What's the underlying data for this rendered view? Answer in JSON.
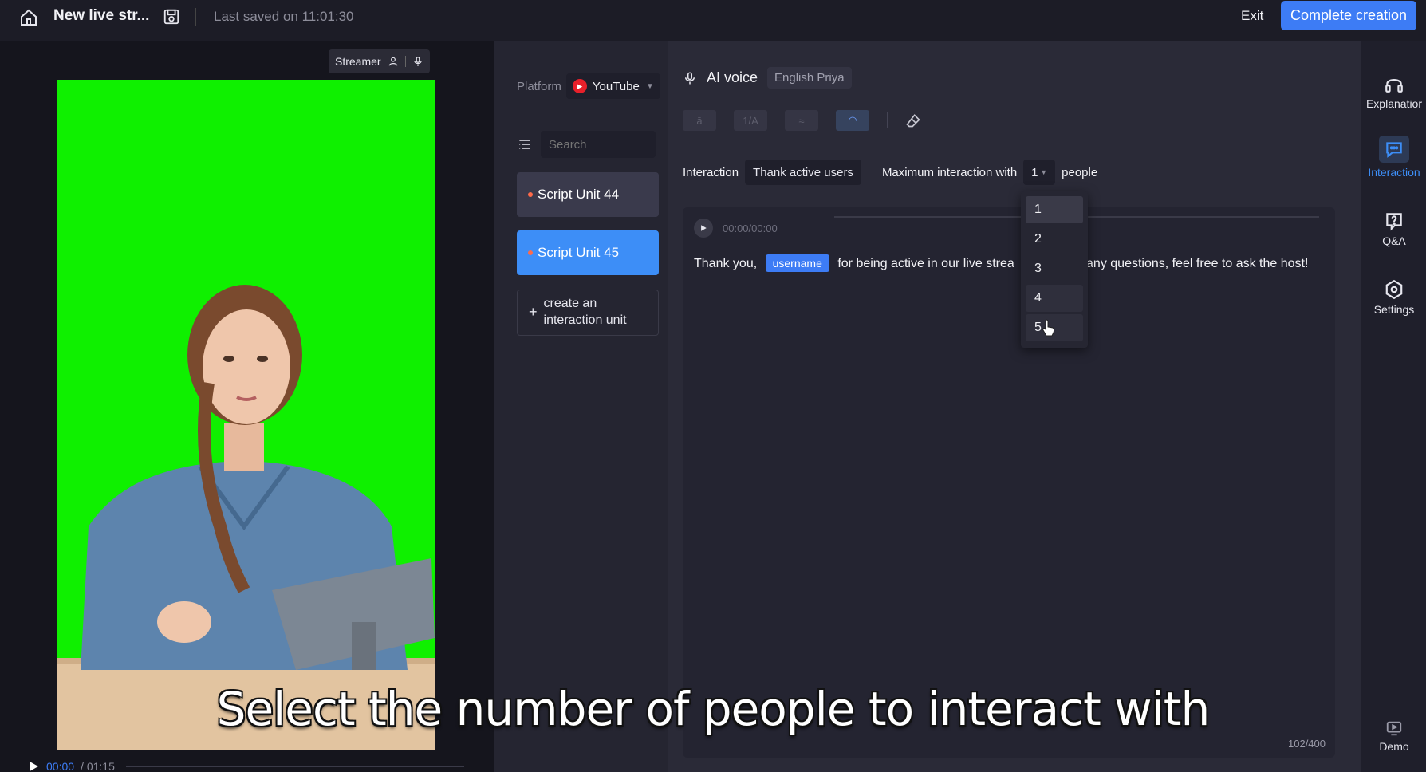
{
  "header": {
    "doc_title": "New live str...",
    "saved_text": "Last saved on 11:01:30",
    "exit_label": "Exit",
    "complete_label": "Complete creation"
  },
  "preview": {
    "streamer_label": "Streamer",
    "time_current": "00:00",
    "time_total": "/ 01:15"
  },
  "sidebar": {
    "platform_label": "Platform",
    "platform_value": "YouTube",
    "search_placeholder": "Search",
    "units": [
      {
        "label": "Script Unit 44"
      },
      {
        "label": "Script Unit 45"
      }
    ],
    "create_label_1": "create an",
    "create_label_2": "interaction unit"
  },
  "main": {
    "voice_title": "AI voice",
    "voice_name": "English Priya",
    "interaction_label": "Interaction",
    "interaction_type": "Thank active users",
    "max_label": "Maximum interaction with",
    "max_value": "1",
    "people_label": "people",
    "audio_time": "00:00/00:00",
    "text_before": "Thank you,",
    "tag": "username",
    "text_after": "for being active in our live strea",
    "text_tail": "ve any questions, feel free to ask the host!",
    "char_count": "102/400"
  },
  "dropdown": {
    "options": [
      "1",
      "2",
      "3",
      "4",
      "5"
    ],
    "selected": "1"
  },
  "right_nav": {
    "explanation": "Explanatior",
    "interaction": "Interaction",
    "qa": "Q&A",
    "settings": "Settings",
    "demo": "Demo"
  },
  "caption": "Select the number of people to interact with",
  "colors": {
    "accent": "#3d7cf5",
    "greenscreen": "#0ff000",
    "unit_active": "#3d8ef7"
  }
}
